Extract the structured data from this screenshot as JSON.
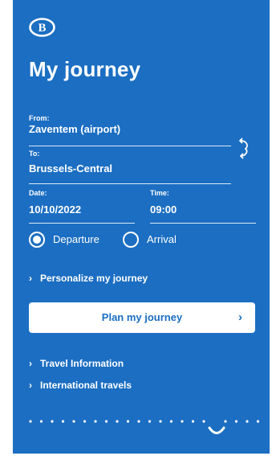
{
  "colors": {
    "panel": "#1b6ec2",
    "text": "#ffffff",
    "button_bg": "#ffffff",
    "button_text": "#1b6ec2"
  },
  "header": {
    "logo_letter": "B",
    "title": "My journey"
  },
  "form": {
    "from": {
      "label": "From:",
      "value": "Zaventem (airport)"
    },
    "to": {
      "label": "To:",
      "value": "Brussels-Central"
    },
    "date": {
      "label": "Date:",
      "value": "10/10/2022"
    },
    "time": {
      "label": "Time:",
      "value": "09:00"
    },
    "swap_icon": "swap-vertical-icon",
    "mode": {
      "options": [
        {
          "label": "Departure",
          "selected": true
        },
        {
          "label": "Arrival",
          "selected": false
        }
      ]
    }
  },
  "links": {
    "personalize": "Personalize my journey",
    "travel_information": "Travel Information",
    "international_travels": "International travels"
  },
  "plan_button": {
    "label": "Plan my journey",
    "arrow": "›"
  },
  "loading_indicator": "dots-spinner-icon"
}
